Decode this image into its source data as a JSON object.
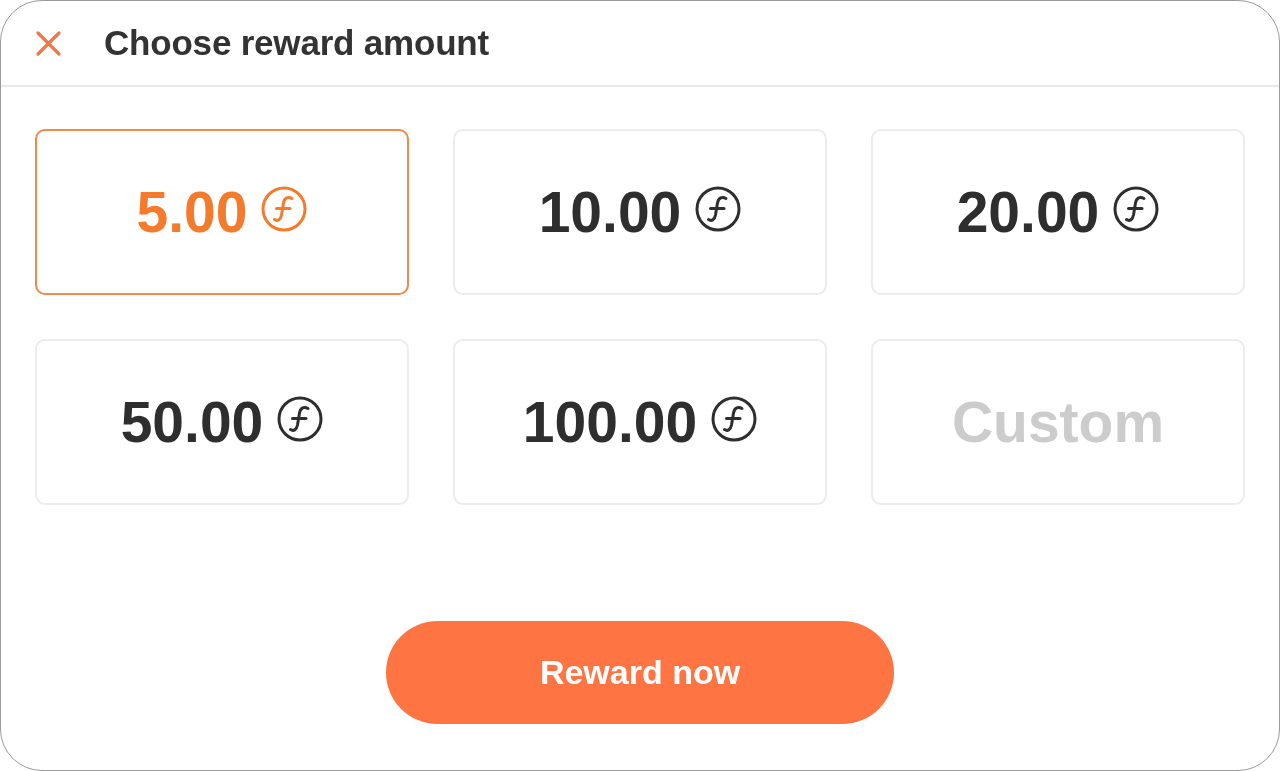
{
  "header": {
    "title": "Choose reward amount"
  },
  "amounts": [
    {
      "kind": "preset",
      "label": "5.00",
      "selected": true
    },
    {
      "kind": "preset",
      "label": "10.00",
      "selected": false
    },
    {
      "kind": "preset",
      "label": "20.00",
      "selected": false
    },
    {
      "kind": "preset",
      "label": "50.00",
      "selected": false
    },
    {
      "kind": "preset",
      "label": "100.00",
      "selected": false
    },
    {
      "kind": "custom",
      "label": "Custom",
      "selected": false
    }
  ],
  "submit_button": {
    "label": "Reward now"
  }
}
